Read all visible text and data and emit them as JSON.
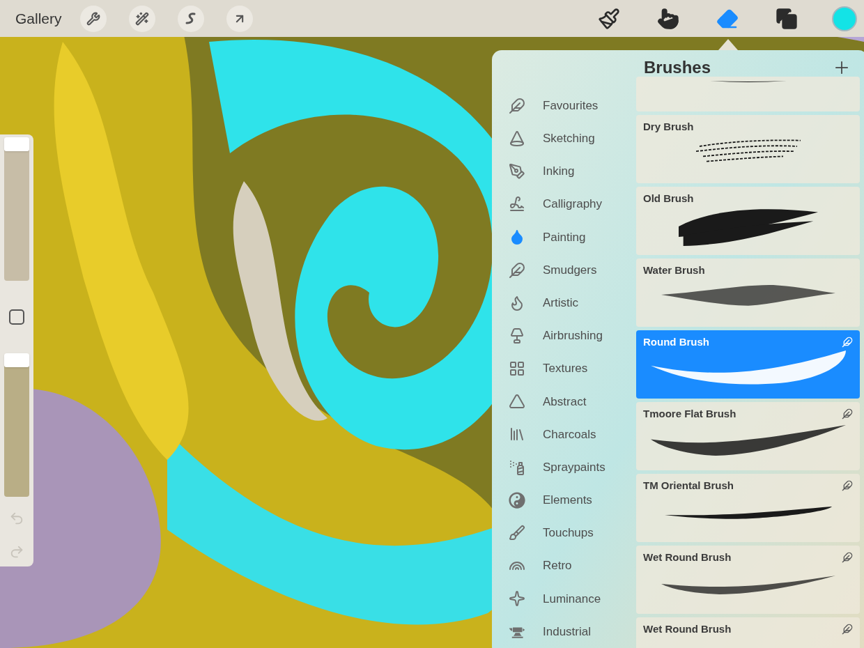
{
  "top_bar": {
    "gallery": "Gallery",
    "left_tools": [
      {
        "selected": false
      },
      {
        "selected": false
      },
      {
        "selected": false
      },
      {
        "selected": false
      }
    ],
    "right_tools": [
      {
        "selected": false
      },
      {
        "selected": false
      },
      {
        "selected": true
      },
      {
        "selected": false
      }
    ],
    "color": "#13e3e6"
  },
  "sidebar": {
    "size_slider": {
      "level": 1
    },
    "opacity_slider": {
      "level": 1
    },
    "undo": {
      "disabled": true
    },
    "redo": {
      "disabled": true
    }
  },
  "brushes_panel": {
    "title": "Brushes",
    "categories": [
      {
        "label": "Favourites",
        "selected": false
      },
      {
        "label": "Sketching",
        "selected": false
      },
      {
        "label": "Inking",
        "selected": false
      },
      {
        "label": "Calligraphy",
        "selected": false
      },
      {
        "label": "Painting",
        "selected": true
      },
      {
        "label": "Smudgers",
        "selected": false
      },
      {
        "label": "Artistic",
        "selected": false
      },
      {
        "label": "Airbrushing",
        "selected": false
      },
      {
        "label": "Textures",
        "selected": false
      },
      {
        "label": "Abstract",
        "selected": false
      },
      {
        "label": "Charcoals",
        "selected": false
      },
      {
        "label": "Spraypaints",
        "selected": false
      },
      {
        "label": "Elements",
        "selected": false
      },
      {
        "label": "Touchups",
        "selected": false
      },
      {
        "label": "Retro",
        "selected": false
      },
      {
        "label": "Luminance",
        "selected": false
      },
      {
        "label": "Industrial",
        "selected": false
      }
    ],
    "brushes": [
      {
        "kind": "thin",
        "selected": false,
        "imported": false
      },
      {
        "name": "Dry Brush",
        "kind": "dry",
        "selected": false,
        "imported": false
      },
      {
        "name": "Old Brush",
        "kind": "old",
        "selected": false,
        "imported": false
      },
      {
        "name": "Water Brush",
        "kind": "water",
        "selected": false,
        "imported": false
      },
      {
        "name": "Round Brush",
        "kind": "round",
        "selected": true,
        "imported": true
      },
      {
        "name": "Tmoore Flat Brush",
        "kind": "flat",
        "selected": false,
        "imported": true
      },
      {
        "name": "TM Oriental Brush",
        "kind": "oriental",
        "selected": false,
        "imported": true
      },
      {
        "name": "Wet Round Brush",
        "kind": "wet",
        "selected": false,
        "imported": true
      },
      {
        "name": "Wet Round Brush",
        "selected": false,
        "imported": true
      }
    ]
  }
}
